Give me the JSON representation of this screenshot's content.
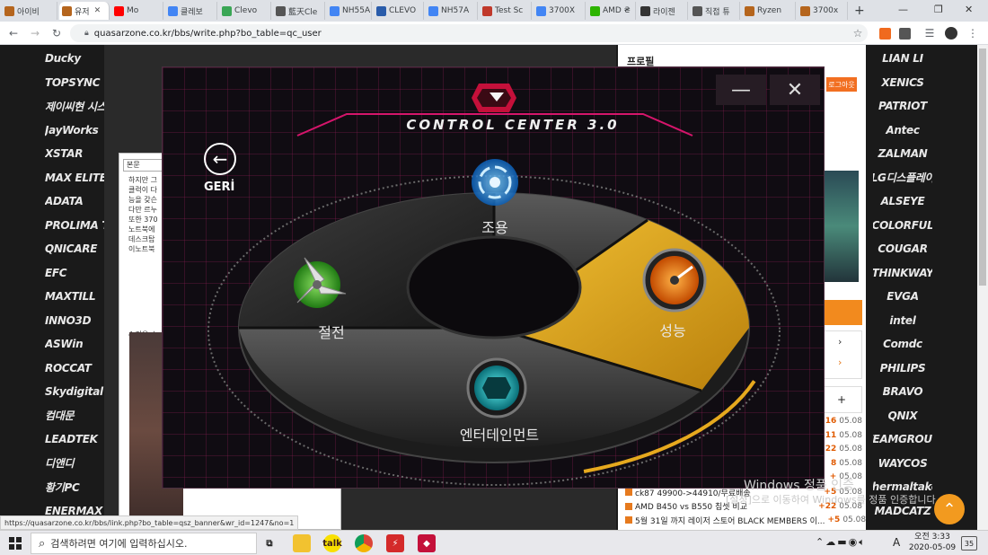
{
  "browser": {
    "tabs": [
      {
        "label": "아이비",
        "color": "#b5651d",
        "icon": "quasarzone-icon"
      },
      {
        "label": "유저",
        "color": "#b5651d",
        "icon": "quasarzone-icon",
        "active": true
      },
      {
        "label": "Mo",
        "color": "#ff0000",
        "icon": "youtube-icon"
      },
      {
        "label": "클레보",
        "color": "#4285f4",
        "icon": "google-icon"
      },
      {
        "label": "Clevo",
        "color": "#3aa655",
        "icon": "site-icon"
      },
      {
        "label": "藍天Cle",
        "color": "#555555",
        "icon": "globe-icon"
      },
      {
        "label": "NH55A",
        "color": "#4285f4",
        "icon": "google-icon"
      },
      {
        "label": "CLEVO",
        "color": "#2a5caa",
        "icon": "site-icon"
      },
      {
        "label": "NH57A",
        "color": "#4285f4",
        "icon": "google-icon"
      },
      {
        "label": "Test Sc",
        "color": "#c0392b",
        "icon": "site-icon"
      },
      {
        "label": "3700X",
        "color": "#4285f4",
        "icon": "google-icon"
      },
      {
        "label": "AMD ₴",
        "color": "#2db400",
        "icon": "naver-icon"
      },
      {
        "label": "라이젠",
        "color": "#333333",
        "icon": "site-icon"
      },
      {
        "label": "직접 튜",
        "color": "#555555",
        "icon": "site-icon"
      },
      {
        "label": "Ryzen",
        "color": "#b5651d",
        "icon": "quasarzone-icon"
      },
      {
        "label": "3700x",
        "color": "#b5651d",
        "icon": "quasarzone-icon"
      }
    ],
    "new_tab": "+",
    "url": "quasarzone.co.kr/bbs/write.php?bo_table=qc_user",
    "status_url": "https://quasarzone.co.kr/bbs/link.php?bo_table=qsz_banner&wr_id=1247&no=1"
  },
  "left_brands": [
    "Ducky",
    "TOPSYNC",
    "제이씨현 시스템㈜",
    "JayWorks",
    "XSTAR",
    "MAX ELITE",
    "ADATA",
    "PROLIMA TECH",
    "QNICARE",
    "EFC",
    "MAXTILL",
    "INNO3D",
    "ASWin",
    "ROCCAT",
    "Skydigital",
    "컴대문",
    "LEADTEK",
    "디앤디",
    "황기PC",
    "ENERMAX"
  ],
  "right_brands": [
    "LIAN LI",
    "XENICS",
    "PATRIOT",
    "Antec",
    "ZALMAN",
    "LG디스플레이",
    "ALSEYE",
    "COLORFUL",
    "COUGAR",
    "THINKWAY",
    "EVGA",
    "intel",
    "Comdc",
    "PHILIPS",
    "BRAVO",
    "QNIX",
    "TEAMGROUP",
    "WAYCOS",
    "thermaltake",
    "MADCATZ"
  ],
  "article": {
    "toolbar_label": "본문",
    "lines": [
      "하지만 그",
      "클럭이 다",
      "능을 갖슨",
      "다만 르누",
      "또한 370",
      "노트북에",
      "데스크탑",
      "이노트북"
    ],
    "section": "4.전용 소"
  },
  "sidebar": {
    "profile": "프로필",
    "logout": "로그아웃",
    "hot_posts": [
      {
        "title": "",
        "count": "16",
        "date": "05.08"
      },
      {
        "title": "",
        "count": "11",
        "date": "05.08"
      },
      {
        "title": "",
        "count": "22",
        "date": "05.08"
      },
      {
        "title": "",
        "count": "8",
        "date": "05.08"
      },
      {
        "title": "",
        "count": "+",
        "date": "05.08"
      },
      {
        "title": "ck87 49900->44910/무료배송",
        "count": "+5",
        "date": "05.08"
      },
      {
        "title": "AMD B450 vs B550 칩셋 비교",
        "count": "+22",
        "date": "05.08"
      },
      {
        "title": "5월 31일 까지 레이저 스토어 BLACK MEMBERS 이...",
        "count": "+5",
        "date": "05.08"
      }
    ],
    "plus": "+"
  },
  "control_center": {
    "title": "CONTROL CENTER 3.0",
    "minimize": "—",
    "close": "✕",
    "back_label": "GERİ",
    "modes": {
      "quiet": "조용",
      "power_saving": "절전",
      "performance": "성능",
      "entertainment": "엔터테인먼트"
    },
    "selected_mode": "performance",
    "colors": {
      "accent": "#e6a91e",
      "brand": "#d5156b",
      "quiet": "#2a8ff0",
      "saving": "#4cd327",
      "entertainment": "#1ec9c9"
    }
  },
  "watermark": {
    "line1": "Windows 정품 인증",
    "line2": "[설정]으로 이동하여 Windows를 정품 인증합니다."
  },
  "taskbar": {
    "search_placeholder": "검색하려면 여기에 입력하십시오.",
    "time": "오전 3:33",
    "date": "2020-05-09",
    "ime": "A",
    "notifications": "35"
  }
}
